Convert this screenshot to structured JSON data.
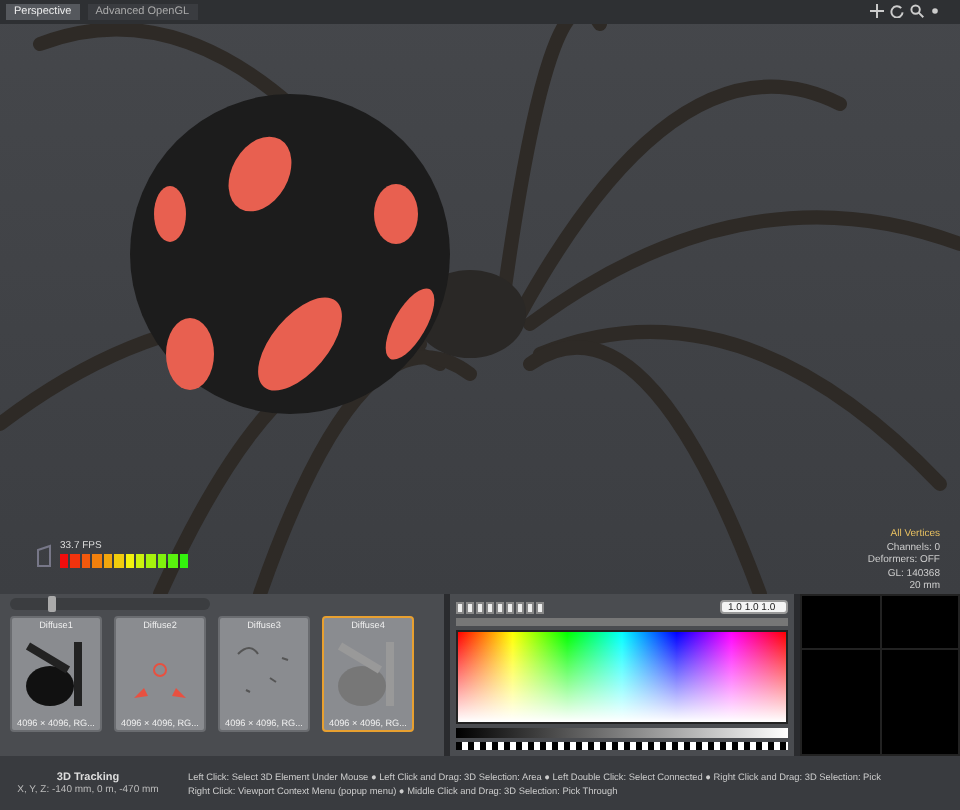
{
  "viewport": {
    "tabs": [
      {
        "label": "Perspective",
        "selected": true
      },
      {
        "label": "Advanced OpenGL",
        "selected": false
      }
    ],
    "fps": {
      "reading": "33.7 FPS",
      "level": 1
    },
    "stats": [
      "All Vertices",
      "Channels: 0",
      "Deformers: OFF",
      "GL: 140368",
      "20 mm"
    ]
  },
  "image_browser": {
    "thumbnail_size": {
      "level": 0.2
    },
    "items": [
      {
        "name": "Diffuse1",
        "info": "4096 × 4096, RG...",
        "selected": false
      },
      {
        "name": "Diffuse2",
        "info": "4096 × 4096, RG...",
        "selected": false
      },
      {
        "name": "Diffuse3",
        "info": "4096 × 4096, RG...",
        "selected": false
      },
      {
        "name": "Diffuse4",
        "info": "4096 × 4096, RG...",
        "selected": true
      }
    ]
  },
  "color_picker": {
    "value": "1.0 1.0 1.0"
  },
  "status_bar": {
    "mode": "3D Tracking",
    "coords": "X, Y, Z:  -140 mm, 0 m, -470 mm",
    "help": [
      "Left Click: Select 3D Element Under Mouse ● Left Click and Drag: 3D Selection: Area ● Left Double Click: Select Connected ● Right Click and Drag: 3D Selection: Pick",
      "Right Click: Viewport Context Menu (popup menu) ● Middle Click and Drag: 3D Selection: Pick Through"
    ]
  }
}
